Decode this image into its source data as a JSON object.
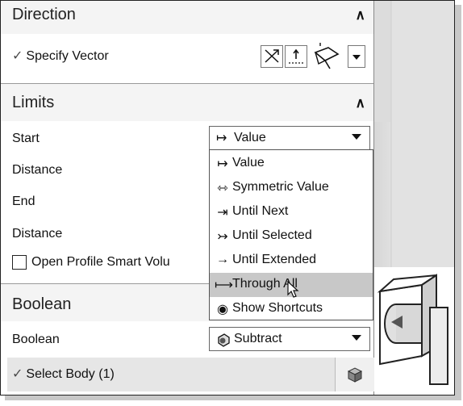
{
  "direction": {
    "title": "Direction",
    "specify_vector": "Specify Vector"
  },
  "limits": {
    "title": "Limits",
    "start_label": "Start",
    "start_value": "Value",
    "distance1_label": "Distance",
    "end_label": "End",
    "distance2_label": "Distance",
    "open_profile_label": "Open Profile Smart Volu"
  },
  "menu": {
    "items": [
      {
        "icon": "value-icon",
        "label": "Value"
      },
      {
        "icon": "symmetric-value-icon",
        "label": "Symmetric Value"
      },
      {
        "icon": "until-next-icon",
        "label": "Until Next"
      },
      {
        "icon": "until-selected-icon",
        "label": "Until Selected"
      },
      {
        "icon": "until-extended-icon",
        "label": "Until Extended"
      },
      {
        "icon": "through-all-icon",
        "label": "Through All"
      },
      {
        "icon": "eye-icon",
        "label": "Show Shortcuts"
      }
    ],
    "highlighted_index": 5
  },
  "boolean": {
    "title": "Boolean",
    "label": "Boolean",
    "value": "Subtract"
  },
  "select_body": {
    "label": "Select Body (1)"
  },
  "colors": {
    "section_bg": "#f4f4f4",
    "highlight": "#c8c8c8",
    "select_row": "#e6e6e6"
  }
}
